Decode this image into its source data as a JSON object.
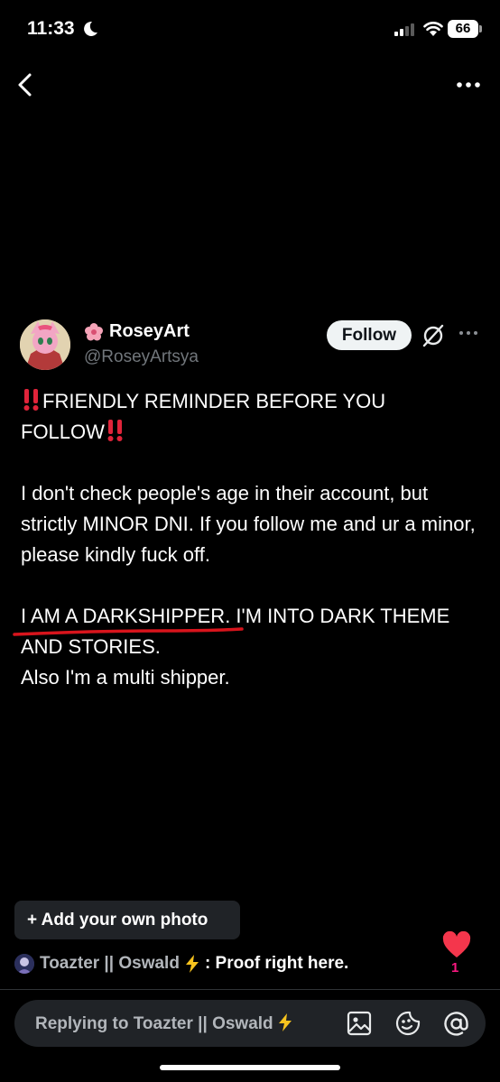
{
  "status_bar": {
    "time": "11:33",
    "battery": "66"
  },
  "post": {
    "display_name": "RoseyArt",
    "handle": "@RoseyArtsya",
    "follow_label": "Follow",
    "paragraph1_a": "FRIENDLY REMINDER BEFORE YOU",
    "paragraph1_b": "FOLLOW",
    "paragraph2": "I don't check people's age in their account, but strictly MINOR DNI. If you follow me and ur a minor, please kindly fuck off.",
    "paragraph3": "I AM A DARKSHIPPER. I'M INTO DARK THEME AND STORIES.",
    "paragraph4": "Also I'm a multi shipper."
  },
  "add_photo_label": "+ Add your own photo",
  "reply": {
    "user": "Toazter || Oswald",
    "text": ": Proof right here.",
    "like_count": "1"
  },
  "composer": {
    "placeholder": "Replying to Toazter || Oswald"
  },
  "colors": {
    "background": "#000000",
    "like": "#f91880",
    "underline": "#d8141c"
  }
}
